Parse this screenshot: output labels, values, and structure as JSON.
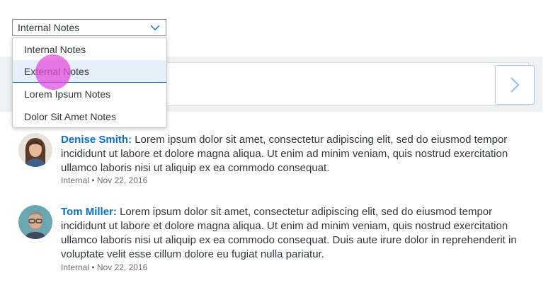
{
  "filter": {
    "selected": "Internal Notes",
    "options": [
      "Internal Notes",
      "External Notes",
      "Lorem Ipsum Notes",
      "Dolor Sit Amet Notes"
    ],
    "highlighted": "External Notes"
  },
  "accent_color": "#0a6ed1",
  "post_button_icon": "chevron-right-icon",
  "posts": [
    {
      "author": "Denise Smith:",
      "text": "Lorem ipsum dolor sit amet, consectetur adipiscing elit, sed do eiusmod tempor incididunt ut labore et dolore magna aliqua. Ut enim ad minim veniam, quis nostrud exercitation ullamco laboris nisi ut aliquip ex ea commodo consequat.",
      "meta": "Internal • Nov 22, 2016"
    },
    {
      "author": "Tom Miller:",
      "text": "Lorem ipsum dolor sit amet, consectetur adipiscing elit, sed do eiusmod tempor incididunt ut labore et dolore magna aliqua. Ut enim ad minim veniam, quis nostrud exercitation ullamco laboris nisi ut aliquip ex ea commodo consequat. Duis aute irure dolor in reprehenderit in voluptate velit esse cillum dolore eu fugiat nulla pariatur.",
      "meta": "Internal • Nov 22, 2016"
    }
  ]
}
